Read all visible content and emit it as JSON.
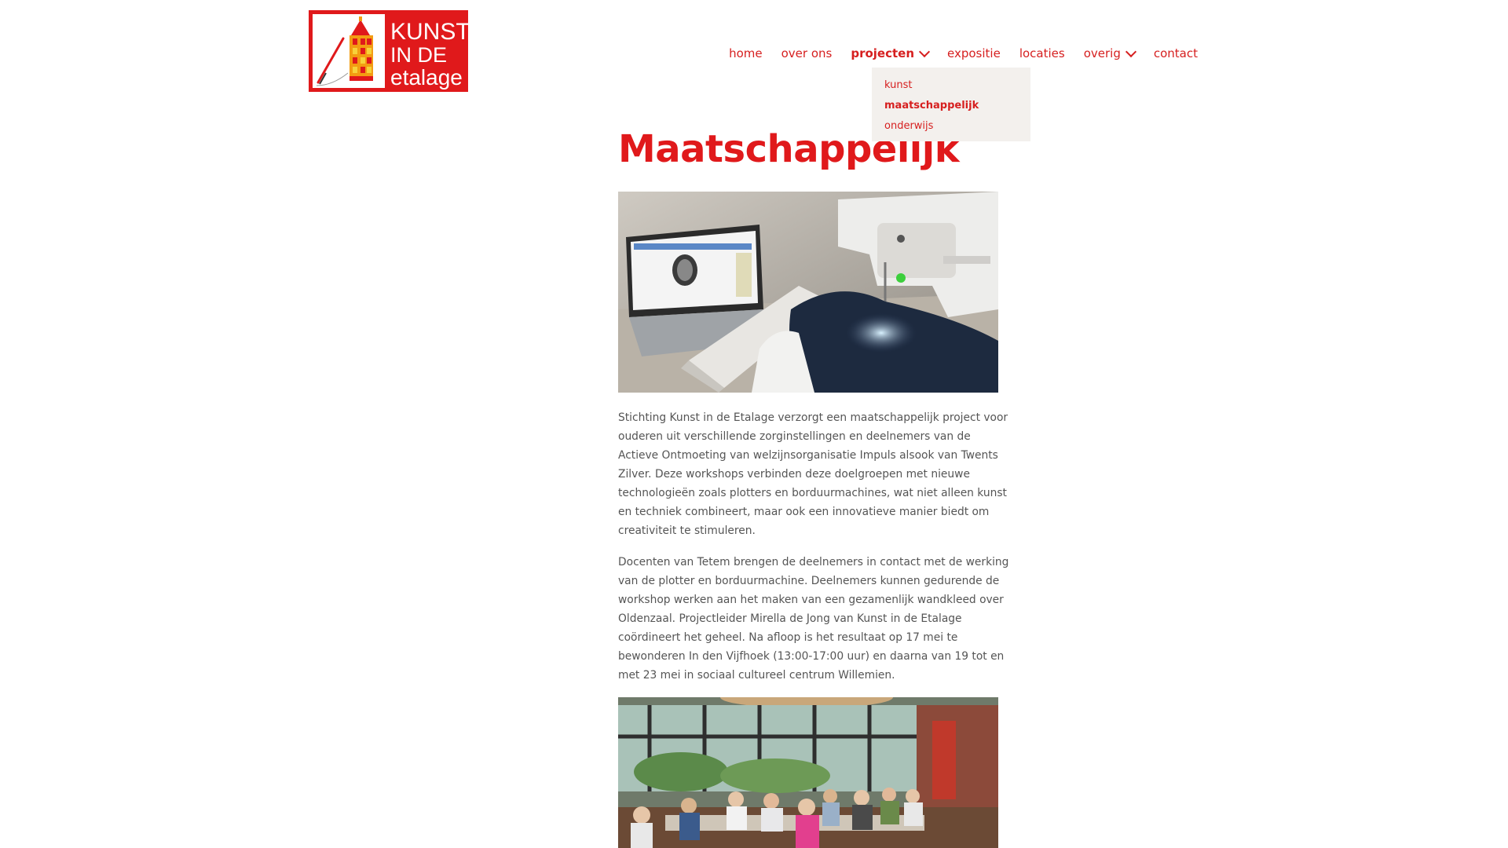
{
  "site": {
    "logo": {
      "line1": "KUNST",
      "line2": "IN DE",
      "line3": "etalage",
      "color": "#e0191b"
    },
    "accent_color": "#d61f1f"
  },
  "nav": {
    "items": [
      {
        "label": "home"
      },
      {
        "label": "over ons"
      },
      {
        "label": "projecten",
        "active": true,
        "has_dropdown": true
      },
      {
        "label": "expositie"
      },
      {
        "label": "locaties"
      },
      {
        "label": "overig",
        "has_dropdown": true
      },
      {
        "label": "contact"
      }
    ],
    "dropdown": {
      "items": [
        {
          "label": "kunst"
        },
        {
          "label": "maatschappelijk",
          "current": true
        },
        {
          "label": "onderwijs"
        }
      ]
    }
  },
  "main": {
    "title": "Maatschappelijk",
    "paragraphs": [
      "Stichting Kunst in de Etalage verzorgt een maatschappelijk project voor ouderen uit verschillende zorginstellingen en deelnemers van de Actieve Ontmoeting van welzijnsorganisatie Impuls alsook van Twents Zilver. Deze workshops verbinden deze doelgroepen met nieuwe technologieën zoals plotters en borduurmachines, wat niet alleen kunst en techniek combineert, maar ook een innovatieve manier biedt om creativiteit te stimuleren.",
      "Docenten van Tetem brengen de deelnemers in contact met de werking van de plotter en borduurmachine. Deelnemers kunnen gedurende de workshop werken aan het maken van een gezamenlijk wandkleed over  Oldenzaal. Projectleider Mirella de Jong van Kunst in de Etalage coördineert het geheel. Na afloop is het resultaat op 17 mei te bewonderen In den Vijfhoek (13:00-17:00 uur) en daarna van 19 tot en met 23 mei in sociaal cultureel centrum Willemien."
    ]
  }
}
